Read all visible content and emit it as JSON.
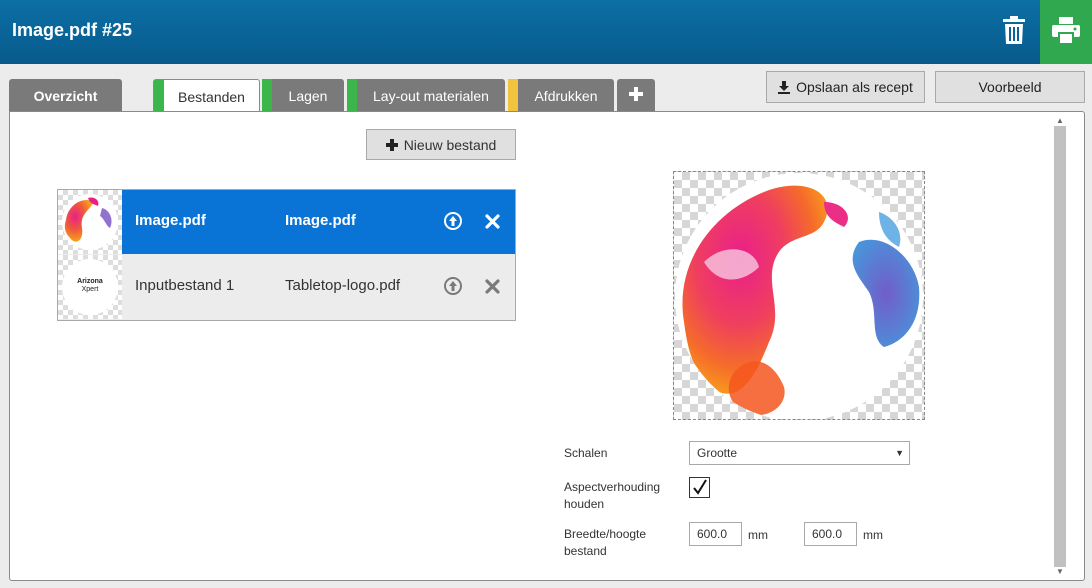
{
  "header": {
    "title": "Image.pdf #25"
  },
  "tabs": [
    {
      "label": "Overzicht"
    },
    {
      "label": "Bestanden",
      "marker": "#3cb54a"
    },
    {
      "label": "Lagen",
      "marker": "#3cb54a"
    },
    {
      "label": "Lay-out materialen",
      "marker": "#3cb54a"
    },
    {
      "label": "Afdrukken",
      "marker": "#f2c43d"
    }
  ],
  "actions": {
    "save_recipe": "Opslaan als recept",
    "preview": "Voorbeeld",
    "new_file": "Nieuw bestand"
  },
  "files": [
    {
      "name": "Image.pdf",
      "source": "Image.pdf",
      "selected": true
    },
    {
      "name": "Inputbestand 1",
      "source": "Tabletop-logo.pdf",
      "selected": false,
      "logo_lines": [
        "Arizona",
        "Xpert"
      ]
    }
  ],
  "form": {
    "scale_label": "Schalen",
    "scale_value": "Grootte",
    "aspect_label_1": "Aspectverhouding",
    "aspect_label_2": "houden",
    "aspect_checked": true,
    "size_label_1": "Breedte/hoogte",
    "size_label_2": "bestand",
    "width": "600.0",
    "height": "600.0",
    "unit": "mm"
  },
  "colors": {
    "header": "#0c6fa5",
    "print": "#2fa84f",
    "selected_row": "#0a74d6"
  },
  "icons": [
    "trash-icon",
    "printer-icon",
    "plus-icon",
    "download-icon",
    "upload-circle-icon",
    "close-icon",
    "chevron-down-icon",
    "checkmark-icon"
  ]
}
